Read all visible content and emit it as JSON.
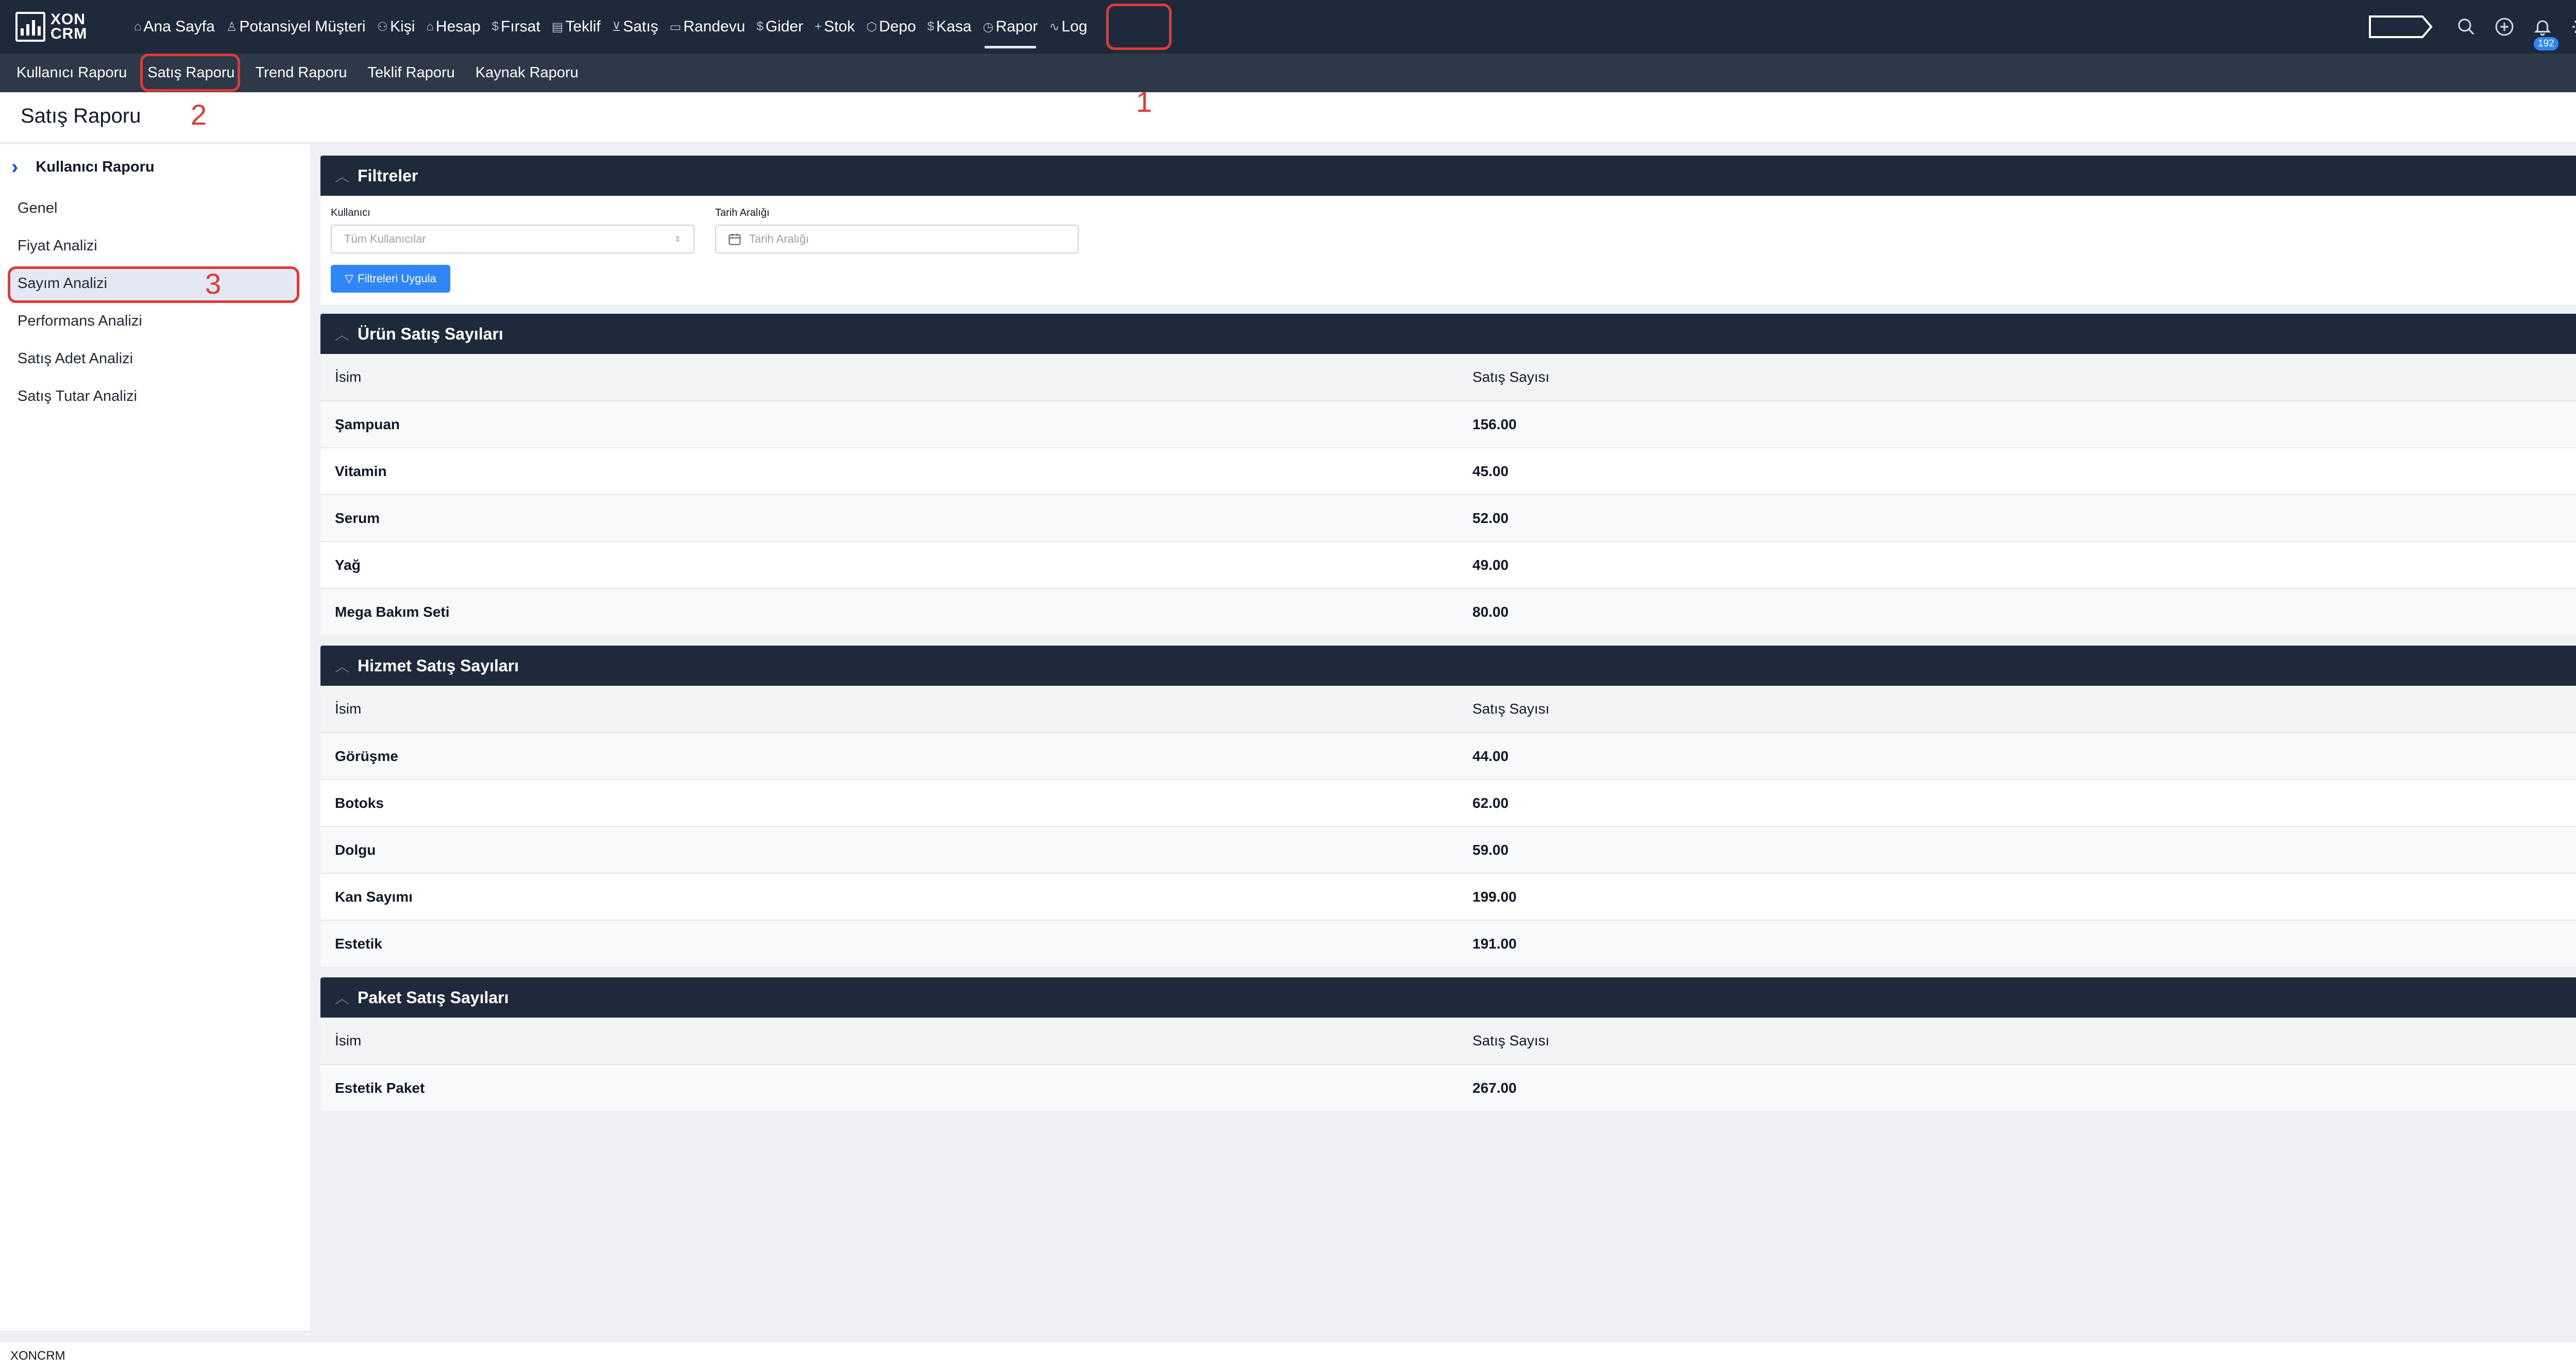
{
  "brand": {
    "line1": "XON",
    "line2": "CRM"
  },
  "nav": [
    {
      "label": "Ana Sayfa",
      "icon": "home-icon"
    },
    {
      "label": "Potansiyel Müşteri",
      "icon": "user-icon"
    },
    {
      "label": "Kişi",
      "icon": "users-icon"
    },
    {
      "label": "Hesap",
      "icon": "bank-icon"
    },
    {
      "label": "Fırsat",
      "icon": "dollar-icon"
    },
    {
      "label": "Teklif",
      "icon": "document-icon"
    },
    {
      "label": "Satış",
      "icon": "cart-icon"
    },
    {
      "label": "Randevu",
      "icon": "calendar-icon"
    },
    {
      "label": "Gider",
      "icon": "dollar-icon"
    },
    {
      "label": "Stok",
      "icon": "plus-icon"
    },
    {
      "label": "Depo",
      "icon": "box-icon"
    },
    {
      "label": "Kasa",
      "icon": "dollar-icon"
    },
    {
      "label": "Rapor",
      "icon": "clock-icon"
    },
    {
      "label": "Log",
      "icon": "activity-icon"
    }
  ],
  "active_nav": "Rapor",
  "notifications": {
    "count": "192"
  },
  "subnav": [
    "Kullanıcı Raporu",
    "Satış Raporu",
    "Trend Raporu",
    "Teklif Raporu",
    "Kaynak Raporu"
  ],
  "annotations": {
    "one": "1",
    "two": "2",
    "three": "3"
  },
  "page_title": "Satış Raporu",
  "sidebar": {
    "header": "Kullanıcı Raporu",
    "items": [
      "Genel",
      "Fiyat Analizi",
      "Sayım Analizi",
      "Performans Analizi",
      "Satış Adet Analizi",
      "Satış Tutar Analizi"
    ],
    "active": "Sayım Analizi"
  },
  "filters": {
    "title": "Filtreler",
    "user_label": "Kullanıcı",
    "user_value": "Tüm Kullanıcılar",
    "date_label": "Tarih Aralığı",
    "date_placeholder": "Tarih Aralığı",
    "apply_label": "Filtreleri Uygula"
  },
  "product_sales": {
    "title": "Ürün Satış Sayıları",
    "col_name": "İsim",
    "col_count": "Satış Sayısı",
    "rows": [
      {
        "name": "Şampuan",
        "count": "156.00"
      },
      {
        "name": "Vitamin",
        "count": "45.00"
      },
      {
        "name": "Serum",
        "count": "52.00"
      },
      {
        "name": "Yağ",
        "count": "49.00"
      },
      {
        "name": "Mega Bakım Seti",
        "count": "80.00"
      }
    ]
  },
  "service_sales": {
    "title": "Hizmet Satış Sayıları",
    "col_name": "İsim",
    "col_count": "Satış Sayısı",
    "rows": [
      {
        "name": "Görüşme",
        "count": "44.00"
      },
      {
        "name": "Botoks",
        "count": "62.00"
      },
      {
        "name": "Dolgu",
        "count": "59.00"
      },
      {
        "name": "Kan Sayımı",
        "count": "199.00"
      },
      {
        "name": "Estetik",
        "count": "191.00"
      }
    ]
  },
  "package_sales": {
    "title": "Paket Satış Sayıları",
    "col_name": "İsim",
    "col_count": "Satış Sayısı",
    "rows": [
      {
        "name": "Estetik Paket",
        "count": "267.00"
      }
    ]
  },
  "footer": "XONCRM"
}
